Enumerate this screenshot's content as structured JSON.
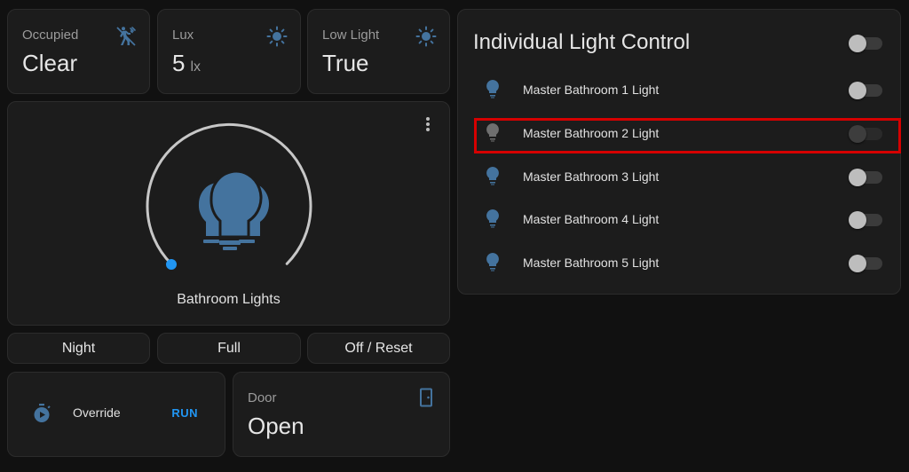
{
  "sensors": [
    {
      "label": "Occupied",
      "value": "Clear",
      "unit": "",
      "icon": "motion-sensor-icon"
    },
    {
      "label": "Lux",
      "value": "5",
      "unit": "lx",
      "icon": "brightness-icon"
    },
    {
      "label": "Low Light",
      "value": "True",
      "unit": "",
      "icon": "brightness-icon"
    }
  ],
  "light_control": {
    "name": "Bathroom Lights",
    "brightness_fraction": 0.0,
    "icon": "lightbulb-group-icon",
    "menu_icon": "more-vertical-icon"
  },
  "scene_buttons": [
    "Night",
    "Full",
    "Off / Reset"
  ],
  "override": {
    "name": "Override",
    "action": "RUN",
    "icon": "timer-play-icon"
  },
  "door": {
    "label": "Door",
    "value": "Open",
    "icon": "door-icon"
  },
  "individual_panel": {
    "title": "Individual Light Control",
    "master_toggle_on": false,
    "lights": [
      {
        "name": "Master Bathroom 1 Light",
        "state": "off",
        "available": true
      },
      {
        "name": "Master Bathroom 2 Light",
        "state": "unavailable",
        "available": false
      },
      {
        "name": "Master Bathroom 3 Light",
        "state": "off",
        "available": true
      },
      {
        "name": "Master Bathroom 4 Light",
        "state": "off",
        "available": true
      },
      {
        "name": "Master Bathroom 5 Light",
        "state": "off",
        "available": true
      }
    ]
  },
  "colors": {
    "accent": "#2196f3",
    "icon_blue": "#44739e",
    "highlight_red": "#d60000",
    "card_bg": "#1c1c1c"
  }
}
